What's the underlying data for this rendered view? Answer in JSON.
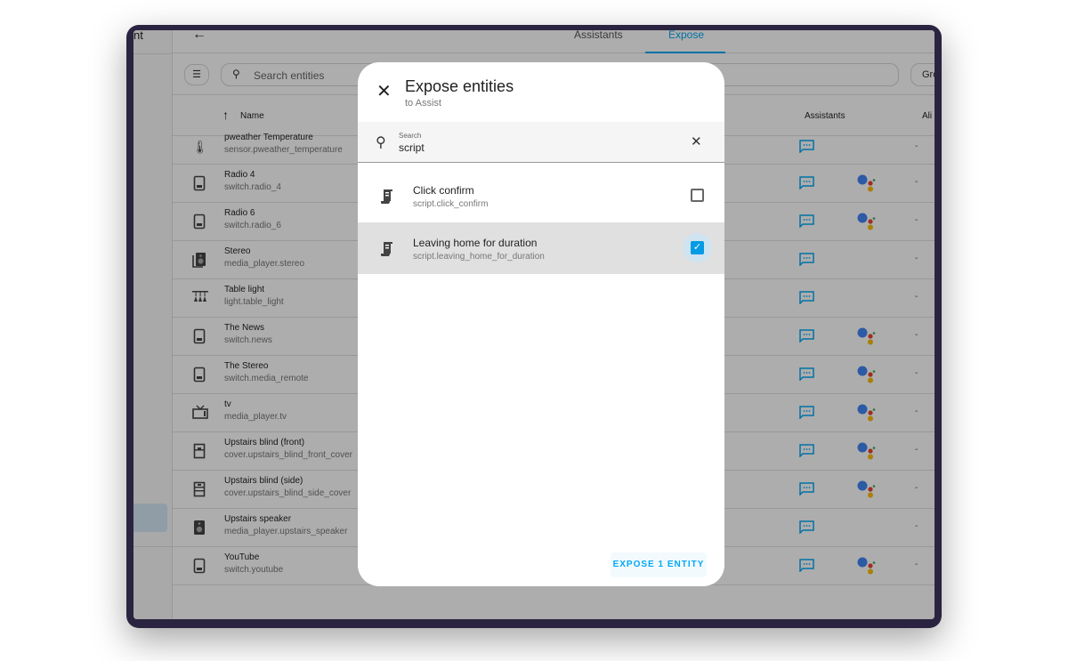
{
  "sidebar": {
    "title_fragment": "nt"
  },
  "header": {
    "back_icon": "arrow-left-icon",
    "tabs": [
      {
        "label": "Assistants",
        "active": false
      },
      {
        "label": "Expose",
        "active": true
      }
    ]
  },
  "toolbar": {
    "filter_icon": "filter-list-icon",
    "search_placeholder": "Search entities",
    "group_label": "Gro"
  },
  "table": {
    "columns": {
      "name": "Name",
      "assistants": "Assistants",
      "aliases": "Ali"
    },
    "sort_icon": "arrow-up-icon",
    "rows": [
      {
        "name": "pweather Temperature",
        "entity_id": "sensor.pweather_temperature",
        "icon": "thermometer-icon",
        "assist": true,
        "google": false,
        "aliases": "-"
      },
      {
        "name": "Radio 4",
        "entity_id": "switch.radio_4",
        "icon": "switch-icon",
        "assist": true,
        "google": true,
        "aliases": "-"
      },
      {
        "name": "Radio 6",
        "entity_id": "switch.radio_6",
        "icon": "switch-icon",
        "assist": true,
        "google": true,
        "aliases": "-"
      },
      {
        "name": "Stereo",
        "entity_id": "media_player.stereo",
        "icon": "speaker-multiple-icon",
        "assist": true,
        "google": false,
        "aliases": "-"
      },
      {
        "name": "Table light",
        "entity_id": "light.table_light",
        "icon": "ceiling-light-multiple-icon",
        "assist": true,
        "google": false,
        "aliases": "-"
      },
      {
        "name": "The News",
        "entity_id": "switch.news",
        "icon": "switch-icon",
        "assist": true,
        "google": true,
        "aliases": "-"
      },
      {
        "name": "The Stereo",
        "entity_id": "switch.media_remote",
        "icon": "switch-icon",
        "assist": true,
        "google": true,
        "aliases": "-"
      },
      {
        "name": "tv",
        "entity_id": "media_player.tv",
        "icon": "television-icon",
        "assist": true,
        "google": true,
        "aliases": "-"
      },
      {
        "name": "Upstairs blind (front)",
        "entity_id": "cover.upstairs_blind_front_cover",
        "icon": "window-shutter-icon",
        "assist": true,
        "google": true,
        "aliases": "-"
      },
      {
        "name": "Upstairs blind (side)",
        "entity_id": "cover.upstairs_blind_side_cover",
        "icon": "window-shutter-open-icon",
        "assist": true,
        "google": true,
        "aliases": "-"
      },
      {
        "name": "Upstairs speaker",
        "entity_id": "media_player.upstairs_speaker",
        "icon": "speaker-icon",
        "assist": true,
        "google": false,
        "aliases": "-"
      },
      {
        "name": "YouTube",
        "entity_id": "switch.youtube",
        "icon": "switch-icon",
        "assist": true,
        "google": true,
        "aliases": "-"
      }
    ]
  },
  "dialog": {
    "title": "Expose entities",
    "subtitle": "to Assist",
    "close_icon": "close-icon",
    "search": {
      "label": "Search",
      "value": "script",
      "clear_icon": "close-icon"
    },
    "items": [
      {
        "name": "Click confirm",
        "entity_id": "script.click_confirm",
        "icon": "script-text-icon",
        "checked": false
      },
      {
        "name": "Leaving home for duration",
        "entity_id": "script.leaving_home_for_duration",
        "icon": "script-text-icon",
        "checked": true
      }
    ],
    "action_label": "EXPOSE 1 ENTITY"
  },
  "colors": {
    "accent": "#03a9f4",
    "checkbox": "#039be5",
    "google_blue": "#4285f4",
    "google_red": "#ea4335",
    "google_yellow": "#fbbc05",
    "google_green": "#34a853"
  }
}
